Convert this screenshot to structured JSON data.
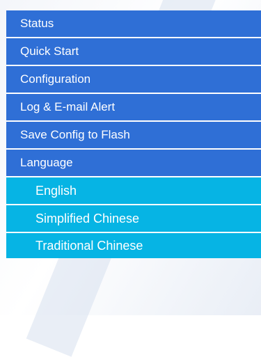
{
  "menu": {
    "items": [
      {
        "label": "Status"
      },
      {
        "label": "Quick Start"
      },
      {
        "label": "Configuration"
      },
      {
        "label": "Log & E-mail Alert"
      },
      {
        "label": "Save Config to Flash"
      },
      {
        "label": "Language"
      }
    ],
    "language_submenu": [
      {
        "label": "English"
      },
      {
        "label": "Simplified Chinese"
      },
      {
        "label": "Traditional Chinese"
      }
    ]
  },
  "colors": {
    "main_item_bg": "#2f6fd6",
    "sub_item_bg": "#06b4e4",
    "text": "#ffffff"
  }
}
